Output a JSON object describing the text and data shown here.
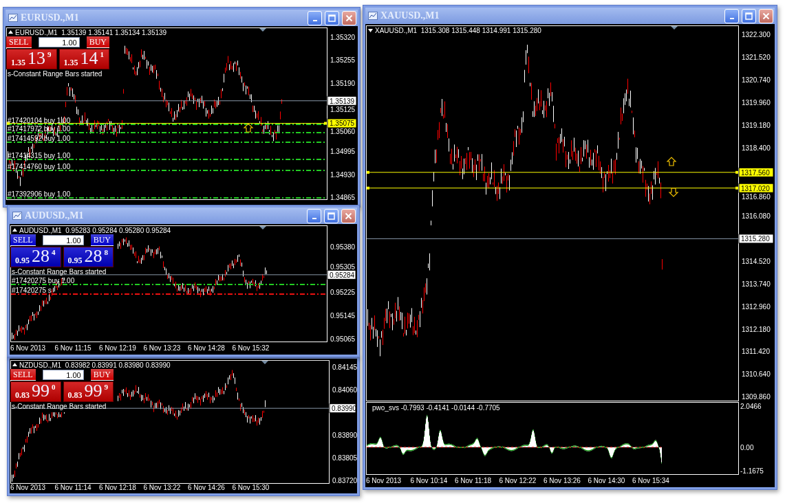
{
  "windows": [
    {
      "title": "EURUSD.,M1",
      "header": "EURUSD.,M1  1.35139 1.35141 1.35134 1.35139",
      "trade_panel": {
        "color": "#cc0000",
        "sell_label": "SELL",
        "buy_label": "BUY",
        "lot": "1.00",
        "sell_price": {
          "prefix": "1.35",
          "big": "13",
          "sup": "9"
        },
        "buy_price": {
          "prefix": "1.35",
          "big": "14",
          "sup": "1"
        }
      },
      "message": "s-Constant Range Bars started",
      "orders": [
        {
          "label": "#17420104 buy 1.00",
          "color": "#22cc22"
        },
        {
          "label": "#17417972 buy 1.00",
          "color": "#22cc22"
        },
        {
          "label": "#17414592 buy 1.00",
          "color": "#22cc22"
        },
        {
          "label": "#17414315 buy 1.00",
          "color": "#22cc22"
        },
        {
          "label": "#17414760 buy 1.00",
          "color": "#22cc22"
        },
        {
          "label": "#17392906 buy 1.00",
          "color": "#22cc22"
        }
      ],
      "price_labels": [
        {
          "text": "1.35320",
          "kind": "tick"
        },
        {
          "text": "1.35255",
          "kind": "tick"
        },
        {
          "text": "1.35190",
          "kind": "tick"
        },
        {
          "text": "1.35139",
          "kind": "bid"
        },
        {
          "text": "1.35125",
          "kind": "tick"
        },
        {
          "text": "1.35075",
          "kind": "level"
        },
        {
          "text": "1.35060",
          "kind": "tick"
        },
        {
          "text": "1.34995",
          "kind": "tick"
        },
        {
          "text": "1.34930",
          "kind": "tick"
        },
        {
          "text": "1.34865",
          "kind": "tick"
        }
      ]
    },
    {
      "title": "AUDUSD.,M1",
      "header": "AUDUSD.,M1  0.95283 0.95284 0.95280 0.95284",
      "trade_panel": {
        "color": "#0000cc",
        "sell_label": "SELL",
        "buy_label": "BUY",
        "lot": "1.00",
        "sell_price": {
          "prefix": "0.95",
          "big": "28",
          "sup": "4"
        },
        "buy_price": {
          "prefix": "0.95",
          "big": "28",
          "sup": "8"
        }
      },
      "message": "s-Constant Range Bars started",
      "orders": [
        {
          "label": "#17420275 buy 1.00",
          "color": "#22cc22"
        },
        {
          "label": "#17420275 s",
          "color": "#ee1111"
        }
      ],
      "price_labels": [
        {
          "text": "0.95380",
          "kind": "tick"
        },
        {
          "text": "0.95305",
          "kind": "tick"
        },
        {
          "text": "0.95284",
          "kind": "bid"
        },
        {
          "text": "0.95225",
          "kind": "tick"
        },
        {
          "text": "0.95145",
          "kind": "tick"
        },
        {
          "text": "0.95065",
          "kind": "tick"
        }
      ],
      "time_labels": [
        "6 Nov 2013",
        "6 Nov 11:15",
        "6 Nov 12:19",
        "6 Nov 13:23",
        "6 Nov 14:28",
        "6 Nov 15:32"
      ]
    },
    {
      "header": "NZDUSD.,M1  0.83982 0.83991 0.83980 0.83990",
      "trade_panel": {
        "color": "#cc0000",
        "sell_label": "SELL",
        "buy_label": "BUY",
        "lot": "1.00",
        "sell_price": {
          "prefix": "0.83",
          "big": "99",
          "sup": "0"
        },
        "buy_price": {
          "prefix": "0.83",
          "big": "99",
          "sup": "9"
        }
      },
      "message": "s-Constant Range Bars started",
      "price_labels": [
        {
          "text": "0.84145",
          "kind": "tick"
        },
        {
          "text": "0.84060",
          "kind": "tick"
        },
        {
          "text": "0.83990",
          "kind": "bid"
        },
        {
          "text": "0.83890",
          "kind": "tick"
        },
        {
          "text": "0.83805",
          "kind": "tick"
        },
        {
          "text": "0.83720",
          "kind": "tick"
        }
      ],
      "time_labels": [
        "6 Nov 2013",
        "6 Nov 11:14",
        "6 Nov 12:18",
        "6 Nov 13:22",
        "6 Nov 14:26",
        "6 Nov 15:30"
      ]
    },
    {
      "title": "XAUUSD.,M1",
      "header": "XAUUSD.,M1  1315.308 1315.448 1314.991 1315.280",
      "price_labels": [
        {
          "text": "1322.300",
          "kind": "tick"
        },
        {
          "text": "1321.520",
          "kind": "tick"
        },
        {
          "text": "1320.740",
          "kind": "tick"
        },
        {
          "text": "1319.960",
          "kind": "tick"
        },
        {
          "text": "1319.180",
          "kind": "tick"
        },
        {
          "text": "1318.400",
          "kind": "tick"
        },
        {
          "text": "1317.560",
          "kind": "level"
        },
        {
          "text": "1317.020",
          "kind": "level"
        },
        {
          "text": "1316.860",
          "kind": "tick"
        },
        {
          "text": "1316.080",
          "kind": "tick"
        },
        {
          "text": "1315.280",
          "kind": "bid"
        },
        {
          "text": "1314.520",
          "kind": "tick"
        },
        {
          "text": "1313.740",
          "kind": "tick"
        },
        {
          "text": "1312.960",
          "kind": "tick"
        },
        {
          "text": "1312.180",
          "kind": "tick"
        },
        {
          "text": "1311.420",
          "kind": "tick"
        },
        {
          "text": "1310.640",
          "kind": "tick"
        },
        {
          "text": "1309.860",
          "kind": "tick"
        }
      ],
      "indicator": {
        "label": "pwo_svs -0.7993 -0.4141 -0.0144 -0.7705",
        "ticks": [
          "2.0466",
          "0.00",
          "-1.1675"
        ]
      },
      "time_labels": [
        "6 Nov 2013",
        "6 Nov 10:14",
        "6 Nov 11:18",
        "6 Nov 12:22",
        "6 Nov 13:26",
        "6 Nov 14:30",
        "6 Nov 15:34"
      ]
    }
  ]
}
